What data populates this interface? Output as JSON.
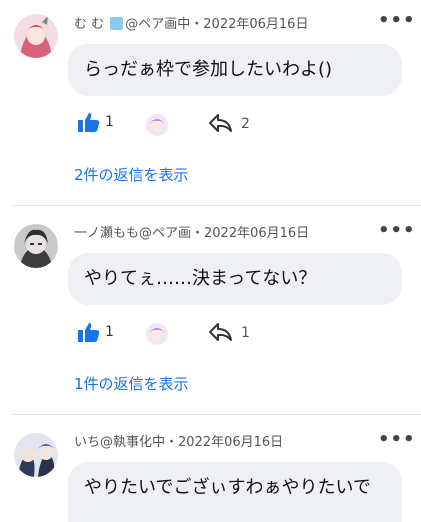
{
  "colors": {
    "link": "#1a73e8",
    "like": "#1a73e8",
    "bubble": "#eef0f3"
  },
  "comments": [
    {
      "author": "む む",
      "author_suffix": "@ペア画中・2022年06月16日",
      "text": "らっだぁ枠で参加したいわよ()",
      "likes": "1",
      "replies": "2",
      "view_replies": "2件の返信を表示"
    },
    {
      "author": "一ノ瀬もも",
      "author_suffix": "@ペア画・2022年06月16日",
      "text": "やりてぇ……決まってない？",
      "likes": "1",
      "replies": "1",
      "view_replies": "1件の返信を表示"
    },
    {
      "author": "いち",
      "author_suffix": "@執事化中・2022年06月16日",
      "text": "やりたいでござぃすわぁやりたいで"
    }
  ]
}
